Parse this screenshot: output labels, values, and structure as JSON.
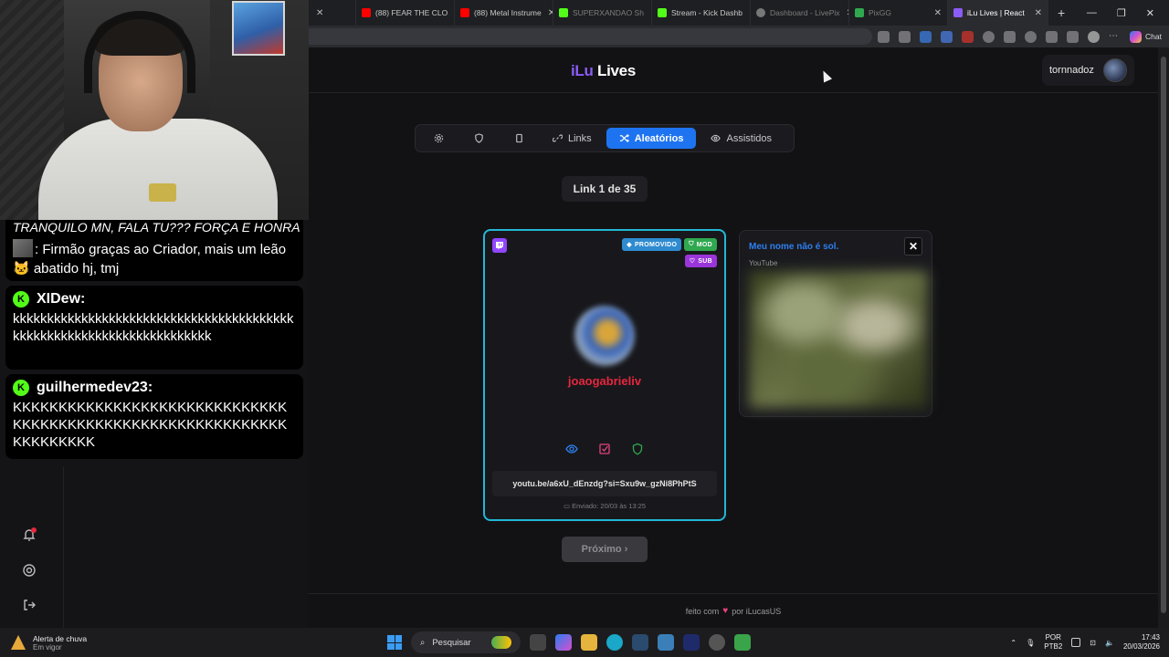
{
  "browser": {
    "tabs": [
      {
        "label": "(88) FEAR THE CLO",
        "fav_color": "#ff0000",
        "state": "normal"
      },
      {
        "label": "(88) Metal Instrume",
        "fav_color": "#ff0000",
        "state": "normal"
      },
      {
        "label": "SUPERXANDAO Sh",
        "fav_color": "#53fc18",
        "state": "dim"
      },
      {
        "label": "Stream - Kick Dashb",
        "fav_color": "#53fc18",
        "state": "normal"
      },
      {
        "label": "Dashboard - LivePix",
        "fav_color": "#777777",
        "state": "dim"
      },
      {
        "label": "PixGG",
        "fav_color": "#2fa84f",
        "state": "dim"
      },
      {
        "label": "iLu Lives | React",
        "fav_color": "#8b5cf6",
        "state": "active"
      }
    ],
    "new_tab": "+",
    "chat_label": "Chat"
  },
  "app": {
    "logo_prefix": "iLu",
    "logo_suffix": " Lives",
    "username": "tornnadoz",
    "nav": {
      "links_label": "Links",
      "random_label": "Aleatórios",
      "watched_label": "Assistidos"
    },
    "counter": "Link 1 de 35",
    "main_card": {
      "badge_promoted": "PROMOVIDO",
      "badge_mod": "MOD",
      "badge_sub": "SUB",
      "name": "joaogabrieliv",
      "link": "youtu.be/a6xU_dEnzdg?si=Sxu9w_gzNi8PhPtS",
      "sent": "Enviado: 20/03 às 13:25"
    },
    "side_card": {
      "title": "Meu nome não é sol.",
      "source": "YouTube",
      "close": "✕"
    },
    "next_label": "Próximo ›",
    "footer_text_1": "feito com",
    "footer_heart": "♥",
    "footer_text_2": "por iLucasUS"
  },
  "overlay_chat": {
    "top_line": "TRANQUILO MN, FALA TU??? FORÇA E HONRA",
    "top_msg": ": Firmão graças ao Criador, mais um leão 🐱 abatido hj, tmj",
    "messages": [
      {
        "user": "XIDew:",
        "text": "kkkkkkkkkkkkkkkkkkkkkkkkkkkkkkkkkkkkkkkkkkkkkkkkkkkkkkkkkkkkkkkkkkkkkk"
      },
      {
        "user": "guilhermedev23:",
        "text": "KKKKKKKKKKKKKKKKKKKKKKKKKKKKKKKKKKKKKKKKKKKKKKKKKKKKKKKKKKKKKKKKKKKKK"
      }
    ],
    "kick_glyph": "K"
  },
  "taskbar": {
    "weather_title": "Alerta de chuva",
    "weather_sub": "Em vigor",
    "search_placeholder": "Pesquisar",
    "lang_1": "POR",
    "lang_2": "PTB2",
    "time": "17:43",
    "date": "20/03/2026"
  },
  "colors": {
    "accent": "#1e74f0",
    "card_border": "#22b7d6",
    "name_red": "#e5273e",
    "brand_purple": "#8b5cf6"
  }
}
